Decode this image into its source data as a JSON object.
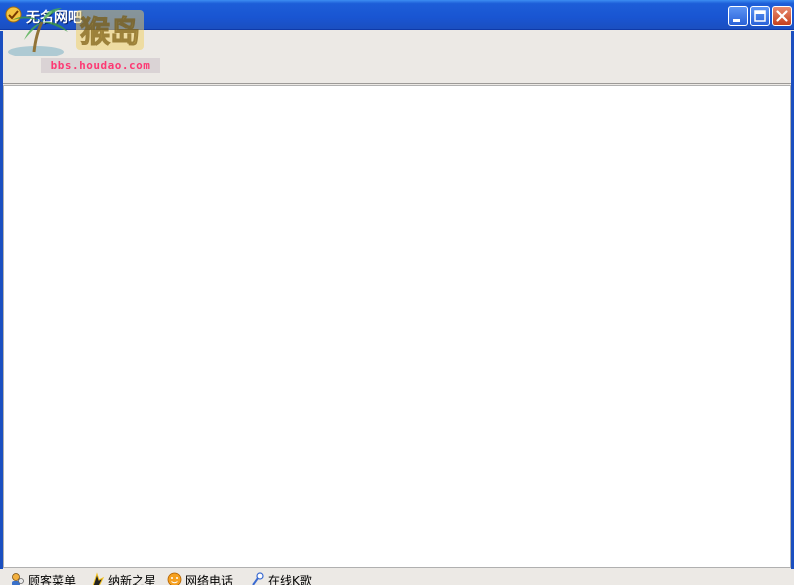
{
  "window": {
    "title": "无名网吧",
    "watermark_url": "bbs.houdao.com",
    "watermark_logo_text": "猴岛"
  },
  "caption_buttons": [
    "minimize",
    "maximize",
    "close"
  ],
  "bottom_bar": {
    "items": [
      {
        "label": "顾客菜单",
        "icon": "customer-icon"
      },
      {
        "label": "纳新之星",
        "icon": "star-figure-icon"
      },
      {
        "label": "网络电话",
        "icon": "phone-face-icon"
      },
      {
        "label": "在线K歌",
        "icon": "microphone-icon"
      }
    ]
  },
  "colors": {
    "titlebar": "#1955d2",
    "close_button": "#c5401c",
    "watermark_url": "#ff2a6a"
  }
}
